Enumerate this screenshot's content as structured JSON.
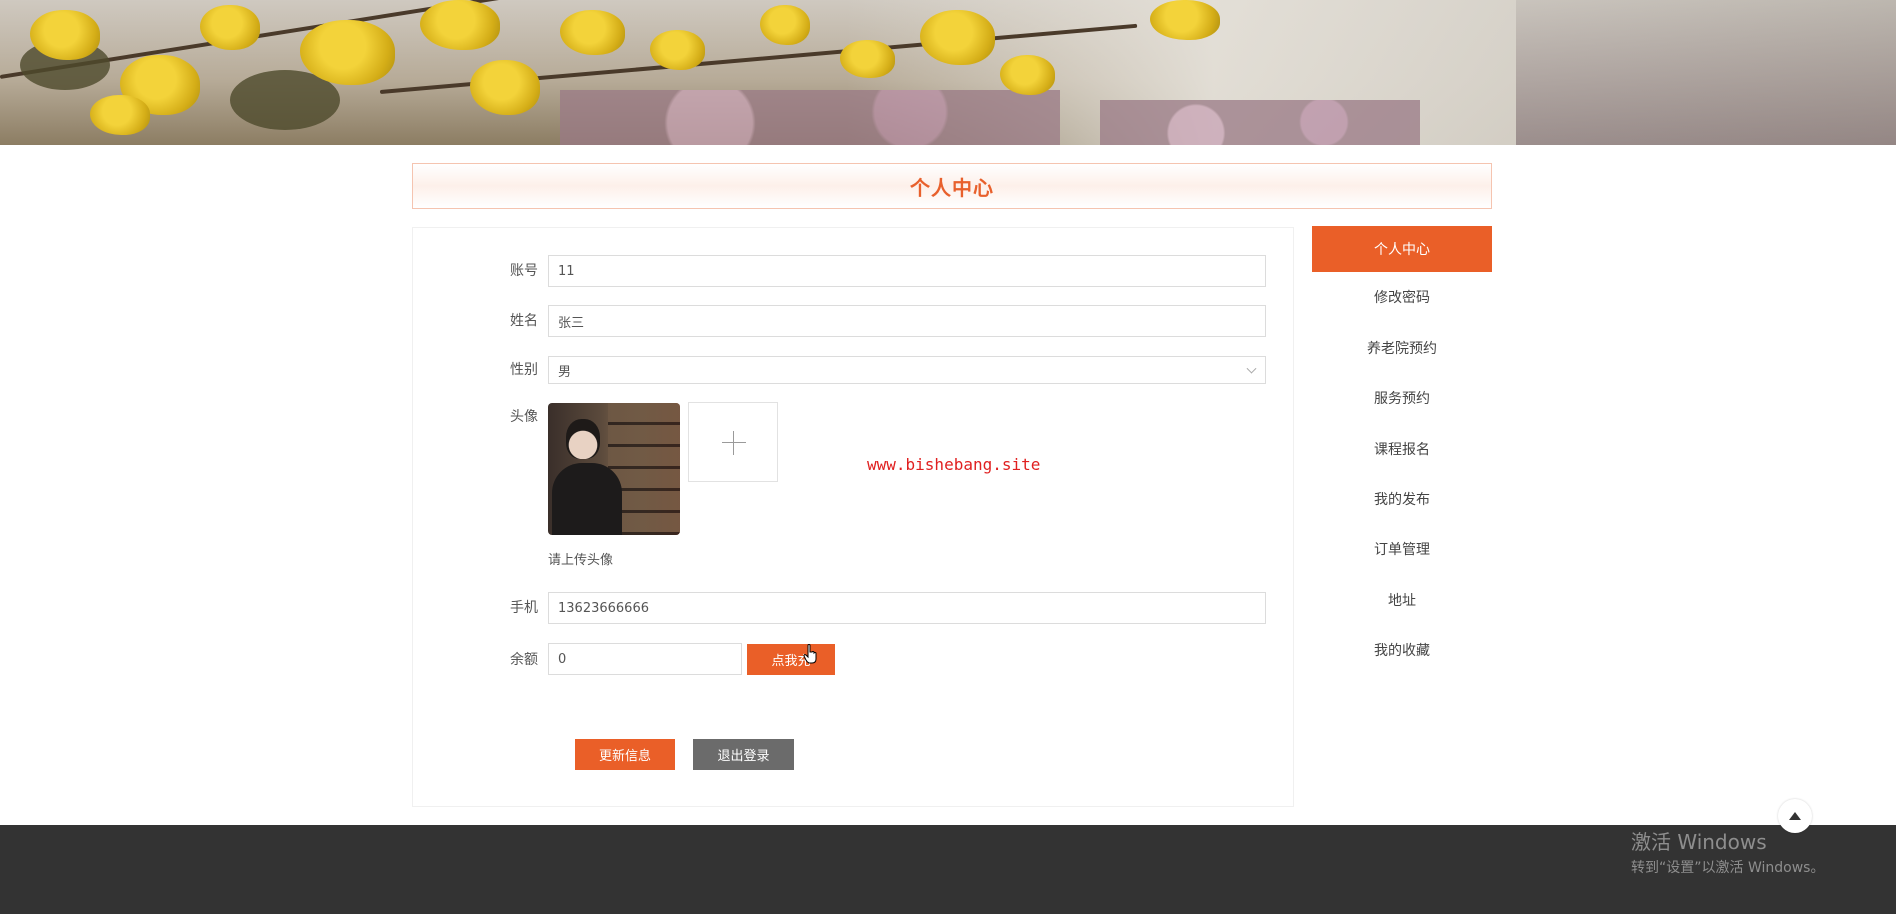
{
  "page_title": "个人中心",
  "form": {
    "account": {
      "label": "账号",
      "value": "11"
    },
    "name": {
      "label": "姓名",
      "value": "张三"
    },
    "gender": {
      "label": "性别",
      "value": "男"
    },
    "avatar": {
      "label": "头像",
      "hint": "请上传头像"
    },
    "phone": {
      "label": "手机",
      "value": "13623666666"
    },
    "balance": {
      "label": "余额",
      "value": "0",
      "recharge_label": "点我充"
    }
  },
  "watermark": "www.bishebang.site",
  "buttons": {
    "update": "更新信息",
    "logout": "退出登录"
  },
  "side_menu": {
    "items": [
      {
        "label": "个人中心",
        "active": true
      },
      {
        "label": "修改密码"
      },
      {
        "label": "养老院预约"
      },
      {
        "label": "服务预约"
      },
      {
        "label": "课程报名"
      },
      {
        "label": "我的发布"
      },
      {
        "label": "订单管理"
      },
      {
        "label": "地址"
      },
      {
        "label": "我的收藏"
      }
    ]
  },
  "windows_activation": {
    "line1": "激活 Windows",
    "line2": "转到“设置”以激活 Windows。"
  },
  "colors": {
    "accent": "#ea5f28",
    "title": "#e8602c",
    "footer": "#333333",
    "watermark": "#e02020"
  }
}
